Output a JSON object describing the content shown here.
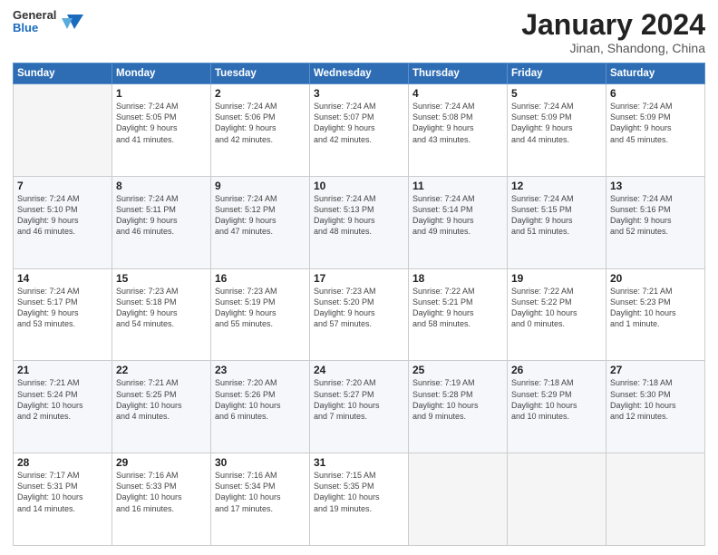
{
  "header": {
    "logo_general": "General",
    "logo_blue": "Blue",
    "title": "January 2024",
    "location": "Jinan, Shandong, China"
  },
  "days_of_week": [
    "Sunday",
    "Monday",
    "Tuesday",
    "Wednesday",
    "Thursday",
    "Friday",
    "Saturday"
  ],
  "weeks": [
    [
      {
        "day": "",
        "info": ""
      },
      {
        "day": "1",
        "info": "Sunrise: 7:24 AM\nSunset: 5:05 PM\nDaylight: 9 hours\nand 41 minutes."
      },
      {
        "day": "2",
        "info": "Sunrise: 7:24 AM\nSunset: 5:06 PM\nDaylight: 9 hours\nand 42 minutes."
      },
      {
        "day": "3",
        "info": "Sunrise: 7:24 AM\nSunset: 5:07 PM\nDaylight: 9 hours\nand 42 minutes."
      },
      {
        "day": "4",
        "info": "Sunrise: 7:24 AM\nSunset: 5:08 PM\nDaylight: 9 hours\nand 43 minutes."
      },
      {
        "day": "5",
        "info": "Sunrise: 7:24 AM\nSunset: 5:09 PM\nDaylight: 9 hours\nand 44 minutes."
      },
      {
        "day": "6",
        "info": "Sunrise: 7:24 AM\nSunset: 5:09 PM\nDaylight: 9 hours\nand 45 minutes."
      }
    ],
    [
      {
        "day": "7",
        "info": "Sunrise: 7:24 AM\nSunset: 5:10 PM\nDaylight: 9 hours\nand 46 minutes."
      },
      {
        "day": "8",
        "info": "Sunrise: 7:24 AM\nSunset: 5:11 PM\nDaylight: 9 hours\nand 46 minutes."
      },
      {
        "day": "9",
        "info": "Sunrise: 7:24 AM\nSunset: 5:12 PM\nDaylight: 9 hours\nand 47 minutes."
      },
      {
        "day": "10",
        "info": "Sunrise: 7:24 AM\nSunset: 5:13 PM\nDaylight: 9 hours\nand 48 minutes."
      },
      {
        "day": "11",
        "info": "Sunrise: 7:24 AM\nSunset: 5:14 PM\nDaylight: 9 hours\nand 49 minutes."
      },
      {
        "day": "12",
        "info": "Sunrise: 7:24 AM\nSunset: 5:15 PM\nDaylight: 9 hours\nand 51 minutes."
      },
      {
        "day": "13",
        "info": "Sunrise: 7:24 AM\nSunset: 5:16 PM\nDaylight: 9 hours\nand 52 minutes."
      }
    ],
    [
      {
        "day": "14",
        "info": "Sunrise: 7:24 AM\nSunset: 5:17 PM\nDaylight: 9 hours\nand 53 minutes."
      },
      {
        "day": "15",
        "info": "Sunrise: 7:23 AM\nSunset: 5:18 PM\nDaylight: 9 hours\nand 54 minutes."
      },
      {
        "day": "16",
        "info": "Sunrise: 7:23 AM\nSunset: 5:19 PM\nDaylight: 9 hours\nand 55 minutes."
      },
      {
        "day": "17",
        "info": "Sunrise: 7:23 AM\nSunset: 5:20 PM\nDaylight: 9 hours\nand 57 minutes."
      },
      {
        "day": "18",
        "info": "Sunrise: 7:22 AM\nSunset: 5:21 PM\nDaylight: 9 hours\nand 58 minutes."
      },
      {
        "day": "19",
        "info": "Sunrise: 7:22 AM\nSunset: 5:22 PM\nDaylight: 10 hours\nand 0 minutes."
      },
      {
        "day": "20",
        "info": "Sunrise: 7:21 AM\nSunset: 5:23 PM\nDaylight: 10 hours\nand 1 minute."
      }
    ],
    [
      {
        "day": "21",
        "info": "Sunrise: 7:21 AM\nSunset: 5:24 PM\nDaylight: 10 hours\nand 2 minutes."
      },
      {
        "day": "22",
        "info": "Sunrise: 7:21 AM\nSunset: 5:25 PM\nDaylight: 10 hours\nand 4 minutes."
      },
      {
        "day": "23",
        "info": "Sunrise: 7:20 AM\nSunset: 5:26 PM\nDaylight: 10 hours\nand 6 minutes."
      },
      {
        "day": "24",
        "info": "Sunrise: 7:20 AM\nSunset: 5:27 PM\nDaylight: 10 hours\nand 7 minutes."
      },
      {
        "day": "25",
        "info": "Sunrise: 7:19 AM\nSunset: 5:28 PM\nDaylight: 10 hours\nand 9 minutes."
      },
      {
        "day": "26",
        "info": "Sunrise: 7:18 AM\nSunset: 5:29 PM\nDaylight: 10 hours\nand 10 minutes."
      },
      {
        "day": "27",
        "info": "Sunrise: 7:18 AM\nSunset: 5:30 PM\nDaylight: 10 hours\nand 12 minutes."
      }
    ],
    [
      {
        "day": "28",
        "info": "Sunrise: 7:17 AM\nSunset: 5:31 PM\nDaylight: 10 hours\nand 14 minutes."
      },
      {
        "day": "29",
        "info": "Sunrise: 7:16 AM\nSunset: 5:33 PM\nDaylight: 10 hours\nand 16 minutes."
      },
      {
        "day": "30",
        "info": "Sunrise: 7:16 AM\nSunset: 5:34 PM\nDaylight: 10 hours\nand 17 minutes."
      },
      {
        "day": "31",
        "info": "Sunrise: 7:15 AM\nSunset: 5:35 PM\nDaylight: 10 hours\nand 19 minutes."
      },
      {
        "day": "",
        "info": ""
      },
      {
        "day": "",
        "info": ""
      },
      {
        "day": "",
        "info": ""
      }
    ]
  ]
}
